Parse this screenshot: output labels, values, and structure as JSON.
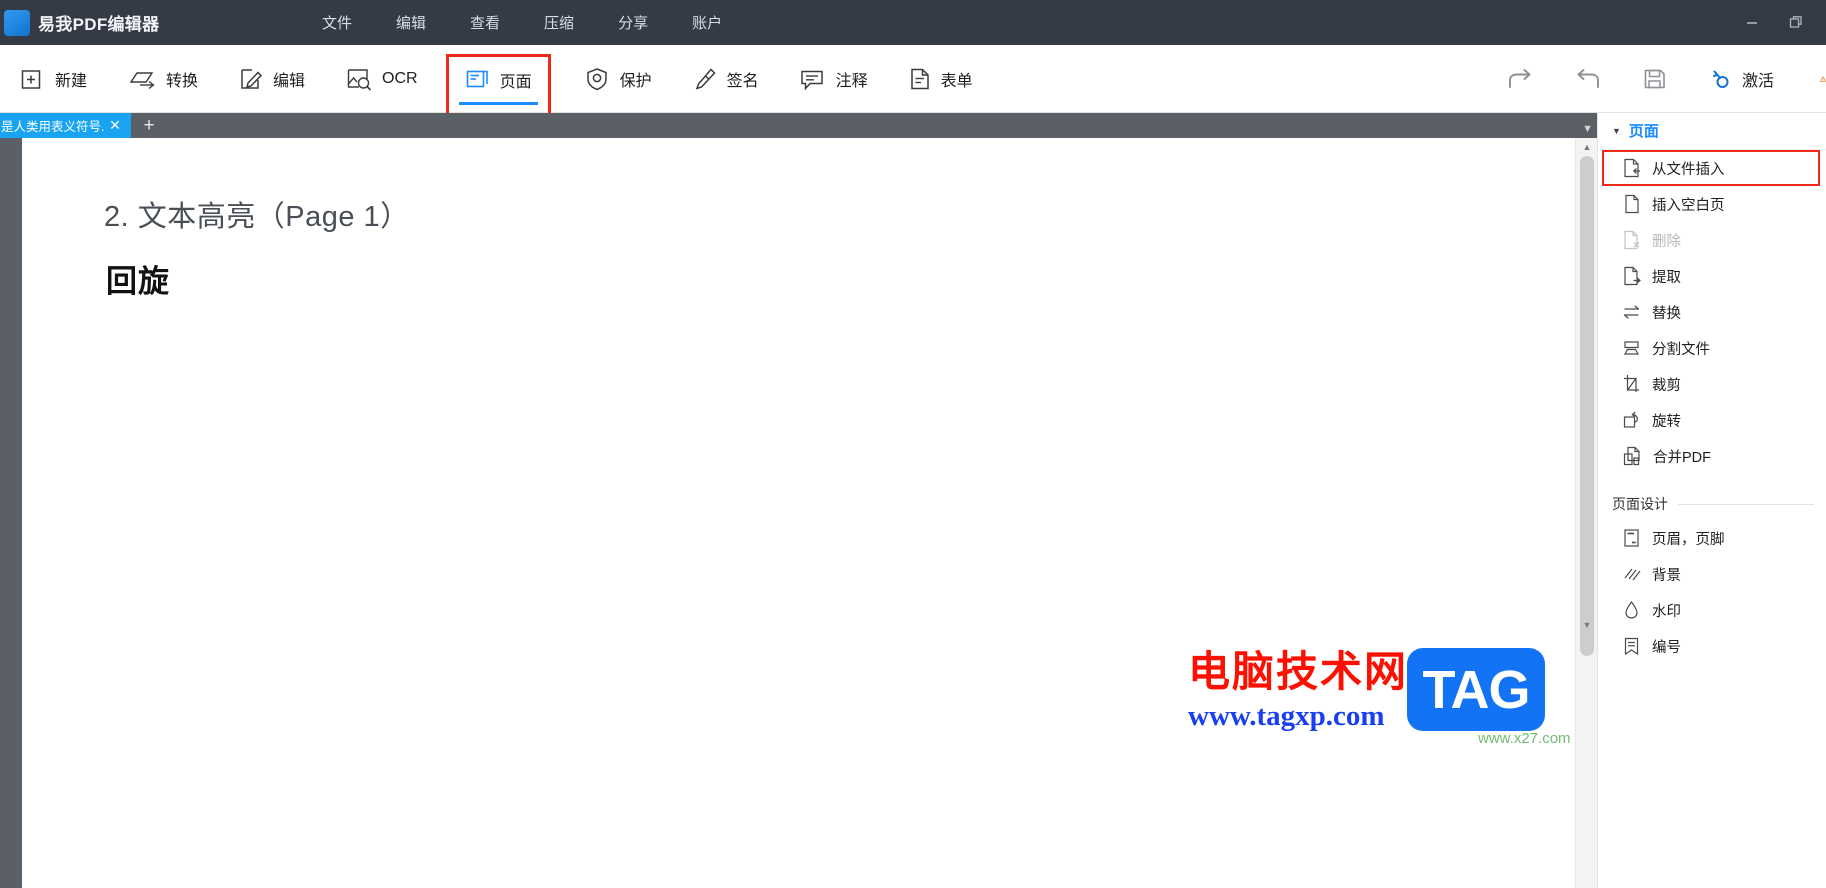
{
  "window": {
    "app_title": "易我PDF编辑器",
    "logo_icon": "app-logo-icon",
    "controls": [
      {
        "name": "minimize-button",
        "icon": "minimize-icon"
      },
      {
        "name": "restore-button",
        "icon": "restore-icon"
      }
    ]
  },
  "menubar": {
    "items": [
      {
        "label": "文件",
        "name": "menu-file"
      },
      {
        "label": "编辑",
        "name": "menu-edit"
      },
      {
        "label": "查看",
        "name": "menu-view"
      },
      {
        "label": "压缩",
        "name": "menu-compress"
      },
      {
        "label": "分享",
        "name": "menu-share"
      },
      {
        "label": "账户",
        "name": "menu-account"
      }
    ]
  },
  "toolbar": {
    "items": [
      {
        "label": "新建",
        "icon": "plus-square-icon",
        "name": "toolbar-new"
      },
      {
        "label": "转换",
        "icon": "convert-icon",
        "name": "toolbar-convert"
      },
      {
        "label": "编辑",
        "icon": "edit-pencil-icon",
        "name": "toolbar-edit"
      },
      {
        "label": "OCR",
        "icon": "ocr-magnifier-icon",
        "name": "toolbar-ocr"
      },
      {
        "label": "页面",
        "icon": "page-icon",
        "name": "toolbar-page"
      },
      {
        "label": "保护",
        "icon": "shield-icon",
        "name": "toolbar-protect"
      },
      {
        "label": "签名",
        "icon": "signature-pen-icon",
        "name": "toolbar-sign"
      },
      {
        "label": "注释",
        "icon": "comment-icon",
        "name": "toolbar-comment"
      },
      {
        "label": "表单",
        "icon": "form-document-icon",
        "name": "toolbar-form"
      }
    ],
    "right": {
      "redo_icon": "redo-arrow-icon",
      "undo_icon": "undo-arrow-icon",
      "save_icon": "save-floppy-icon",
      "activate_icon": "key-icon",
      "activate_label": "激活",
      "warning_icon": "warning-icon"
    },
    "selected": "页面",
    "highlight_color": "#ef2a18",
    "active_underline_color": "#1a8cff"
  },
  "tabstrip": {
    "tab_title": "是人类用表义符号...",
    "close_icon": "close-icon",
    "new_tab_icon": "plus-icon",
    "overflow_icon": "chevron-down-icon",
    "active_tab_color": "#19a4f2"
  },
  "document": {
    "heading": "2. 文本高亮（Page 1）",
    "body_text": "回旋"
  },
  "scrollbar": {
    "up_icon": "caret-up-icon",
    "down_icon": "caret-down-icon"
  },
  "sidebar": {
    "header": {
      "title": "页面",
      "caret_icon": "caret-down-icon"
    },
    "items": [
      {
        "label": "从文件插入",
        "icon": "insert-from-file-icon",
        "name": "sidebar-item-insert-from-file",
        "state": "highlighted"
      },
      {
        "label": "插入空白页",
        "icon": "blank-page-icon",
        "name": "sidebar-item-insert-blank-page",
        "state": "normal"
      },
      {
        "label": "删除",
        "icon": "page-delete-icon",
        "name": "sidebar-item-delete",
        "state": "disabled"
      },
      {
        "label": "提取",
        "icon": "page-extract-icon",
        "name": "sidebar-item-extract",
        "state": "normal"
      },
      {
        "label": "替换",
        "icon": "swap-arrows-icon",
        "name": "sidebar-item-replace",
        "state": "normal"
      },
      {
        "label": "分割文件",
        "icon": "split-file-icon",
        "name": "sidebar-item-split-file",
        "state": "normal"
      },
      {
        "label": "裁剪",
        "icon": "crop-icon",
        "name": "sidebar-item-crop",
        "state": "normal"
      },
      {
        "label": "旋转",
        "icon": "rotate-icon",
        "name": "sidebar-item-rotate",
        "state": "normal"
      },
      {
        "label": "合并PDF",
        "icon": "merge-pdf-icon",
        "name": "sidebar-item-merge-pdf",
        "state": "normal"
      }
    ],
    "section": {
      "label": "页面设计"
    },
    "design_items": [
      {
        "label": "页眉，页脚",
        "icon": "header-footer-icon",
        "name": "sidebar-item-header-footer"
      },
      {
        "label": "背景",
        "icon": "background-icon",
        "name": "sidebar-item-background"
      },
      {
        "label": "水印",
        "icon": "watermark-drop-icon",
        "name": "sidebar-item-watermark"
      },
      {
        "label": "编号",
        "icon": "numbering-icon",
        "name": "sidebar-item-numbering"
      }
    ],
    "accent_color": "#1a8cff",
    "highlight_color": "#ef2a18"
  },
  "watermark": {
    "title_cn": "电脑技术网",
    "url": "www.tagxp.com",
    "badge": "TAG",
    "sub": "www.x27.com",
    "title_color": "#fc1002",
    "url_color": "#1a3ff0",
    "badge_color": "#1273f5"
  }
}
